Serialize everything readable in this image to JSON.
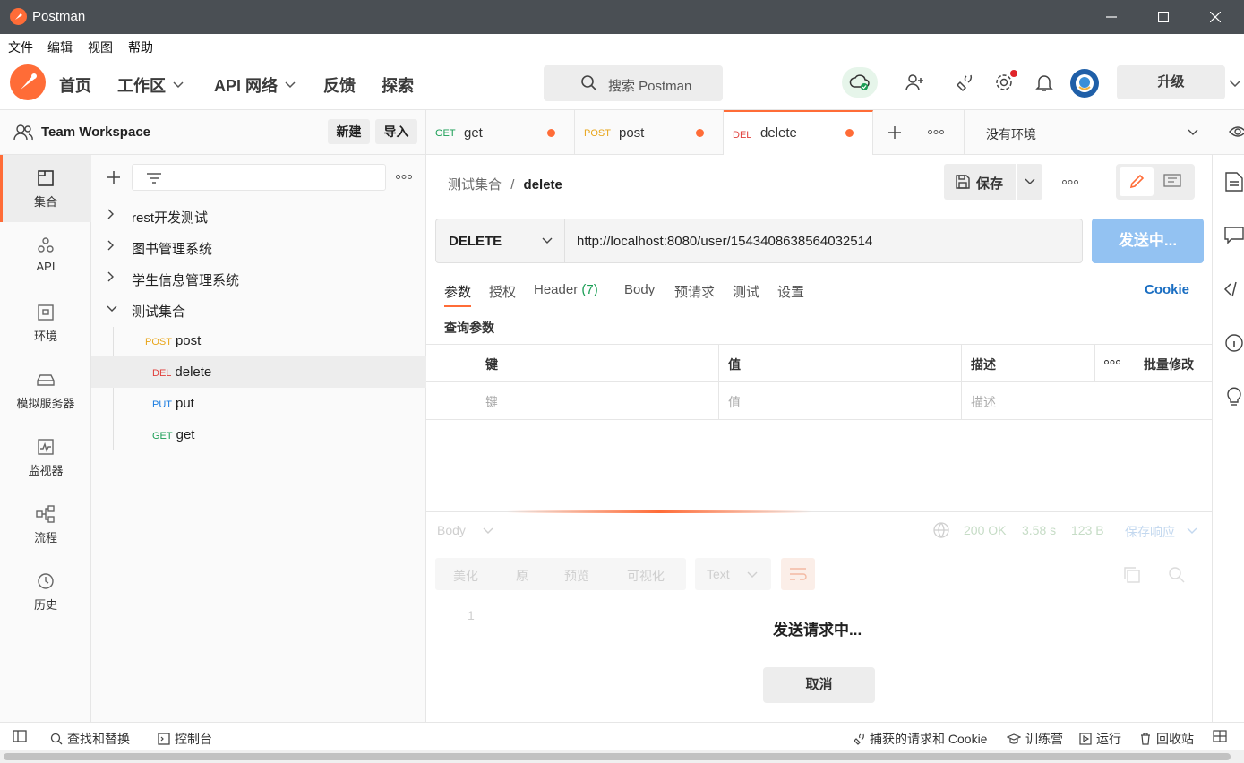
{
  "window": {
    "title": "Postman"
  },
  "menubar": [
    "文件",
    "编辑",
    "视图",
    "帮助"
  ],
  "header": {
    "nav": [
      {
        "label": "首页",
        "dropdown": false
      },
      {
        "label": "工作区",
        "dropdown": true
      },
      {
        "label": "API 网络",
        "dropdown": true
      },
      {
        "label": "反馈",
        "dropdown": false
      },
      {
        "label": "探索",
        "dropdown": false
      }
    ],
    "search_placeholder": "搜索 Postman",
    "upgrade_label": "升级"
  },
  "workspace": {
    "name": "Team Workspace",
    "new_label": "新建",
    "import_label": "导入"
  },
  "rail": [
    {
      "label": "集合",
      "icon": "collections-icon"
    },
    {
      "label": "API",
      "icon": "api-icon"
    },
    {
      "label": "环境",
      "icon": "environment-icon"
    },
    {
      "label": "模拟服务器",
      "icon": "mock-server-icon"
    },
    {
      "label": "监视器",
      "icon": "monitor-icon"
    },
    {
      "label": "流程",
      "icon": "flows-icon"
    },
    {
      "label": "历史",
      "icon": "history-icon"
    }
  ],
  "collections": [
    {
      "name": "rest开发测试"
    },
    {
      "name": "图书管理系统"
    },
    {
      "name": "学生信息管理系统"
    },
    {
      "name": "测试集合"
    }
  ],
  "requests": [
    {
      "method": "POST",
      "name": "post",
      "color": "#e8a51a"
    },
    {
      "method": "DEL",
      "name": "delete",
      "color": "#e0403c"
    },
    {
      "method": "PUT",
      "name": "put",
      "color": "#1a7ce0"
    },
    {
      "method": "GET",
      "name": "get",
      "color": "#1a9e55"
    }
  ],
  "tabs": [
    {
      "method": "GET",
      "name": "get",
      "color": "#1a9e55"
    },
    {
      "method": "POST",
      "name": "post",
      "color": "#e8a51a"
    },
    {
      "method": "DEL",
      "name": "delete",
      "color": "#e0403c"
    }
  ],
  "environment": "没有环境",
  "request": {
    "breadcrumb_parent": "测试集合",
    "breadcrumb_sep": "/",
    "breadcrumb_name": "delete",
    "save_label": "保存",
    "method": "DELETE",
    "url": "http://localhost:8080/user/1543408638564032514",
    "send_label": "发送中...",
    "subtabs": [
      "参数",
      "授权",
      "Header",
      "Body",
      "预请求",
      "测试",
      "设置"
    ],
    "header_count": "(7)",
    "cookie_label": "Cookie",
    "query_params_label": "查询参数",
    "table_headers": {
      "key": "键",
      "value": "值",
      "desc": "描述",
      "bulk": "批量修改"
    },
    "table_placeholders": {
      "key": "键",
      "value": "值",
      "desc": "描述"
    }
  },
  "response": {
    "body_label": "Body",
    "status": "200 OK",
    "time": "3.58 s",
    "size": "123 B",
    "save_response": "保存响应",
    "view_tabs": [
      "美化",
      "原",
      "预览",
      "可视化"
    ],
    "format": "Text",
    "line_no": "1",
    "sending_text": "发送请求中...",
    "cancel_label": "取消"
  },
  "statusbar": {
    "find_replace": "查找和替换",
    "console": "控制台",
    "capture": "捕获的请求和 Cookie",
    "bootcamp": "训练营",
    "runner": "运行",
    "trash": "回收站"
  },
  "colors": {
    "accent": "#ff6c37",
    "send_button": "#93c2f2",
    "link": "#1a6ec2"
  }
}
